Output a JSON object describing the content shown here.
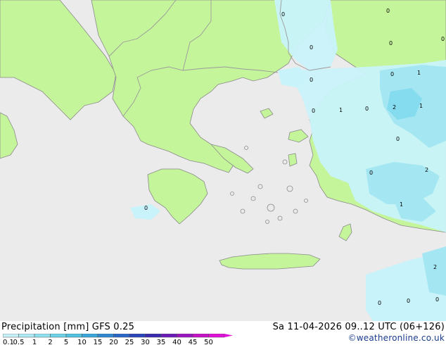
{
  "footer": {
    "title": "Precipitation [mm]  GFS 0.25",
    "datetime": "Sa 11-04-2026 09..12 UTC (06+126)",
    "credit": "©weatheronline.co.uk"
  },
  "legend": {
    "ticks": [
      "0.1",
      "0.5",
      "1",
      "2",
      "5",
      "10",
      "15",
      "20",
      "25",
      "30",
      "35",
      "40",
      "45",
      "50"
    ],
    "colors": [
      "#c8f0f8",
      "#aeeaf5",
      "#8ee0ef",
      "#6cd3e8",
      "#4ec2e0",
      "#3aa7da",
      "#2e88d2",
      "#2a66c8",
      "#2a44bc",
      "#3a2ab0",
      "#6a1cb8",
      "#9a14c0",
      "#c810c8",
      "#e010d8"
    ]
  },
  "colors": {
    "sea": "#ebebeb",
    "land": "#c5f59a",
    "coast": "#8a8a8a",
    "border": "#9a9a9a",
    "precip_light": "#c9f3fa",
    "precip_mid": "#a4e7f3",
    "precip_high": "#84dcee"
  },
  "map_values": [
    "0",
    "0",
    "0",
    "0",
    "0",
    "0",
    "0",
    "1",
    "0",
    "2",
    "1",
    "0",
    "1",
    "0",
    "0",
    "2",
    "1",
    "0",
    "2",
    "0",
    "0",
    "0"
  ]
}
